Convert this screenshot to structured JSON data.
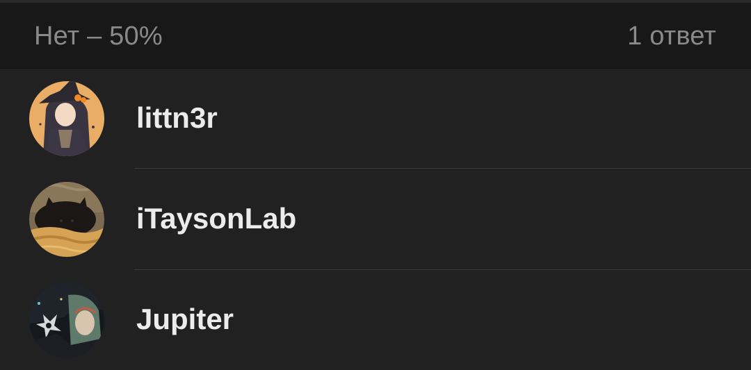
{
  "header": {
    "option_label": "Нет – 50%",
    "answer_count": "1 ответ"
  },
  "voters": [
    {
      "name": "littn3r",
      "avatar_icon": "witch-girl-avatar",
      "avatar_bg": "#e3a25a"
    },
    {
      "name": "iTaysonLab",
      "avatar_icon": "black-cat-avatar",
      "avatar_bg": "#c89a5a"
    },
    {
      "name": "Jupiter",
      "avatar_icon": "anime-art-avatar",
      "avatar_bg": "#1a1d22"
    }
  ]
}
